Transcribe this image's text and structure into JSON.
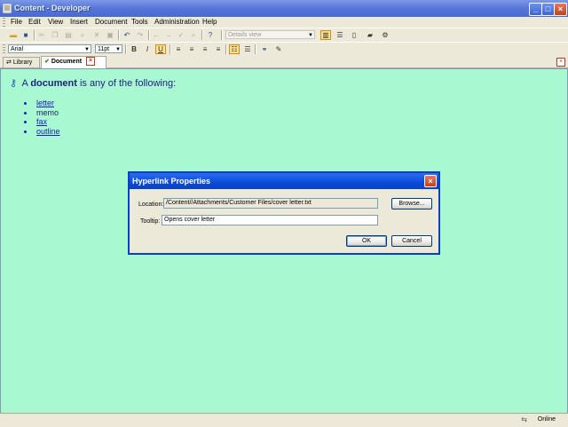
{
  "window": {
    "title": "Content - Developer"
  },
  "menu": [
    "File",
    "Edit",
    "View",
    "Insert",
    "Document",
    "Tools",
    "Administration",
    "Help"
  ],
  "toolbar": {
    "view_combo": "Details view"
  },
  "format": {
    "font": "Arial",
    "size": "11pt",
    "bold": "B",
    "italic": "I",
    "underline": "U"
  },
  "tabs": [
    {
      "label": "Library"
    },
    {
      "label": "Document"
    }
  ],
  "document": {
    "intro_prefix": "A",
    "intro_bold": "document",
    "intro_suffix": "is any of the following:",
    "items": [
      {
        "text": "letter",
        "link": true
      },
      {
        "text": "memo",
        "link": false
      },
      {
        "text": "fax",
        "link": true
      },
      {
        "text": "outline",
        "link": true
      }
    ]
  },
  "dialog": {
    "title": "Hyperlink Properties",
    "location_label": "Location:",
    "location_value": "/Content//Attachments/Customer Files/cover letter.txt",
    "browse_label": "Browse...",
    "tooltip_label": "Tooltip:",
    "tooltip_value": "Opens cover letter",
    "ok_label": "OK",
    "cancel_label": "Cancel"
  },
  "status": {
    "text": "Online"
  },
  "colors": {
    "content_bg": "#A8F8D2",
    "link": "#1A1AC0",
    "titlebar": "#5574D8"
  }
}
